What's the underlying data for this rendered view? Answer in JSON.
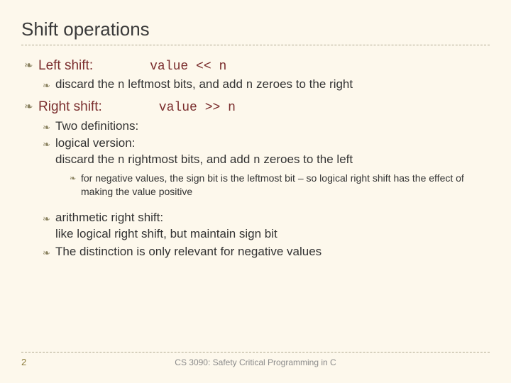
{
  "title": "Shift operations",
  "left": {
    "heading": "Left shift:",
    "code": "value << n",
    "sub1_a": "discard the ",
    "sub1_n1": "n",
    "sub1_b": " leftmost bits, and add ",
    "sub1_n2": "n",
    "sub1_c": " zeroes to the right"
  },
  "right": {
    "heading": "Right shift:",
    "code": "value >> n",
    "two_def": "Two definitions:",
    "logical_a": "logical version:",
    "logical_b1": "discard the ",
    "logical_n1": "n",
    "logical_b2": " rightmost bits, and add ",
    "logical_n2": "n",
    "logical_b3": " zeroes to the left",
    "neg_note": "for negative values, the sign bit is the leftmost bit – so logical right shift has the effect of making the value positive",
    "arith_a": "arithmetic right shift:",
    "arith_b": "like logical right shift, but maintain sign bit",
    "distinction": "The distinction is only relevant for negative values"
  },
  "footer": {
    "page": "2",
    "course": "CS 3090: Safety Critical Programming in C"
  }
}
